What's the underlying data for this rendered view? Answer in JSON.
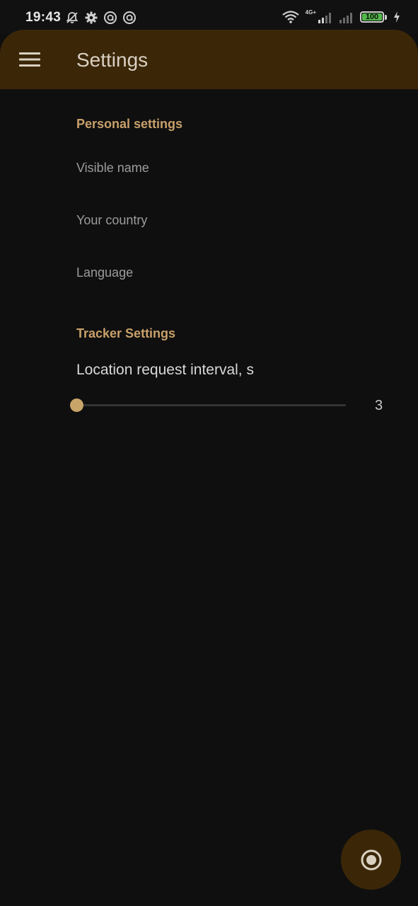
{
  "status_bar": {
    "time": "19:43",
    "network_label": "4G+",
    "battery_level": "100",
    "icons_left": [
      "bell-off-icon",
      "gear-icon",
      "circle-a-icon",
      "circle-a-icon"
    ],
    "icons_right": [
      "wifi-icon",
      "signal-4g-icon",
      "signal-icon",
      "battery-icon",
      "charging-icon"
    ]
  },
  "app_bar": {
    "title": "Settings",
    "menu_icon": "hamburger-menu-icon"
  },
  "sections": {
    "personal": {
      "header": "Personal settings",
      "items": [
        {
          "label": "Visible name"
        },
        {
          "label": "Your country"
        },
        {
          "label": "Language"
        }
      ]
    },
    "tracker": {
      "header": "Tracker Settings",
      "slider": {
        "title": "Location request interval, s",
        "value": "3",
        "fraction": 0
      }
    }
  },
  "fab": {
    "icon": "record-icon"
  },
  "colors": {
    "accent": "#c8a06a",
    "app_bar": "#3b2708",
    "background": "#0f0f0f",
    "slider_thumb": "#c9a468",
    "battery_fill": "#53b94a"
  }
}
